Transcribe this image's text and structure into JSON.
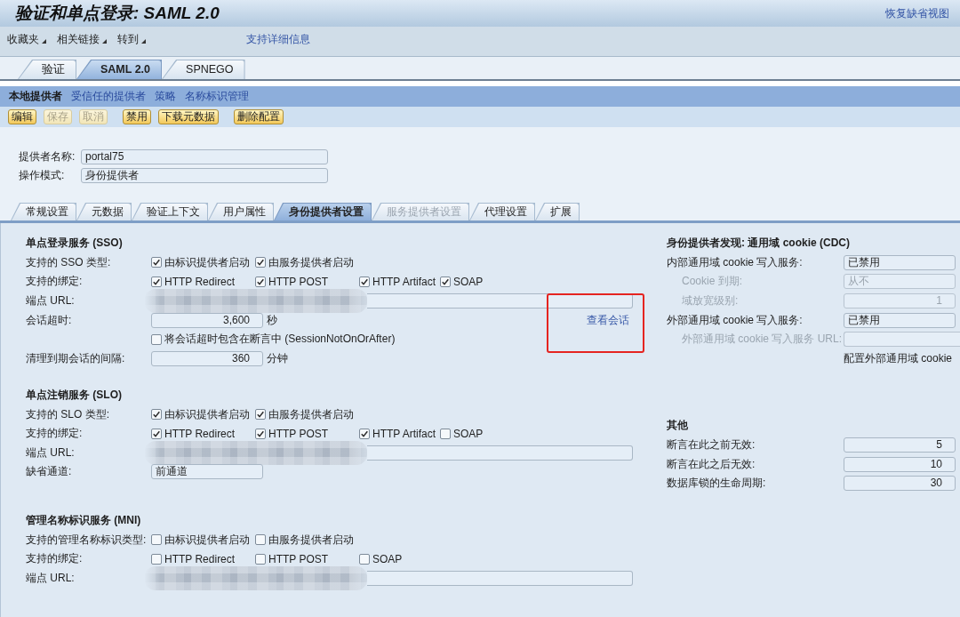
{
  "header": {
    "title": "验证和单点登录: SAML 2.0",
    "restore_link": "恢复缺省视图"
  },
  "menu": {
    "items": [
      "收藏夹",
      "相关链接",
      "转到"
    ],
    "support_link": "支持详细信息"
  },
  "top_tabs": [
    {
      "label": "验证",
      "selected": false
    },
    {
      "label": "SAML 2.0",
      "selected": true
    },
    {
      "label": "SPNEGO",
      "selected": false
    }
  ],
  "subnav": [
    {
      "label": "本地提供者",
      "selected": true
    },
    {
      "label": "受信任的提供者",
      "selected": false
    },
    {
      "label": "策略",
      "selected": false
    },
    {
      "label": "名称标识管理",
      "selected": false
    }
  ],
  "toolbar": {
    "groups": [
      [
        {
          "label": "编辑",
          "disabled": false
        },
        {
          "label": "保存",
          "disabled": true
        },
        {
          "label": "取消",
          "disabled": true
        }
      ],
      [
        {
          "label": "禁用",
          "disabled": false
        },
        {
          "label": "下载元数据",
          "disabled": false
        }
      ],
      [
        {
          "label": "删除配置",
          "disabled": false
        }
      ]
    ]
  },
  "provider": [
    {
      "label": "提供者名称:",
      "value": "portal75"
    },
    {
      "label": "操作模式:",
      "value": "身份提供者"
    }
  ],
  "detail_tabs": [
    {
      "label": "常规设置",
      "selected": false,
      "disabled": false
    },
    {
      "label": "元数据",
      "selected": false,
      "disabled": false
    },
    {
      "label": "验证上下文",
      "selected": false,
      "disabled": false
    },
    {
      "label": "用户属性",
      "selected": false,
      "disabled": false
    },
    {
      "label": "身份提供者设置",
      "selected": true,
      "disabled": false
    },
    {
      "label": "服务提供者设置",
      "selected": false,
      "disabled": true
    },
    {
      "label": "代理设置",
      "selected": false,
      "disabled": false
    },
    {
      "label": "扩展",
      "selected": false,
      "disabled": false
    }
  ],
  "left_sections": [
    {
      "title": "单点登录服务 (SSO)",
      "rows": [
        {
          "kind": "checks",
          "label": "支持的 SSO 类型:",
          "options": [
            {
              "label": "由标识提供者启动",
              "checked": true
            },
            {
              "label": "由服务提供者启动",
              "checked": true
            }
          ]
        },
        {
          "kind": "checks",
          "label": "支持的绑定:",
          "options": [
            {
              "label": "HTTP Redirect",
              "checked": true
            },
            {
              "label": "HTTP POST",
              "checked": true
            },
            {
              "label": "HTTP Artifact",
              "checked": true
            },
            {
              "label": "SOAP",
              "checked": true
            }
          ]
        },
        {
          "kind": "url",
          "label": "端点 URL:",
          "redacted": true
        },
        {
          "kind": "number",
          "label": "会话超时:",
          "value": "3,600",
          "unit": "秒",
          "link": {
            "label": "查看会话",
            "highlighted": true
          }
        },
        {
          "kind": "checks",
          "options": [
            {
              "label": "将会话超时包含在断言中 (SessionNotOnOrAfter)",
              "checked": false
            }
          ]
        },
        {
          "kind": "number",
          "label": "清理到期会话的间隔:",
          "value": "360",
          "unit": "分钟"
        }
      ]
    },
    {
      "title": "单点注销服务 (SLO)",
      "rows": [
        {
          "kind": "checks",
          "label": "支持的 SLO 类型:",
          "options": [
            {
              "label": "由标识提供者启动",
              "checked": true
            },
            {
              "label": "由服务提供者启动",
              "checked": true
            }
          ]
        },
        {
          "kind": "checks",
          "label": "支持的绑定:",
          "options": [
            {
              "label": "HTTP Redirect",
              "checked": true
            },
            {
              "label": "HTTP POST",
              "checked": true
            },
            {
              "label": "HTTP Artifact",
              "checked": true
            },
            {
              "label": "SOAP",
              "checked": false
            }
          ]
        },
        {
          "kind": "url",
          "label": "端点 URL:",
          "redacted": true
        },
        {
          "kind": "text",
          "label": "缺省通道:",
          "value": "前通道"
        }
      ]
    },
    {
      "title": "管理名称标识服务 (MNI)",
      "rows": [
        {
          "kind": "checks",
          "label": "支持的管理名称标识类型:",
          "options": [
            {
              "label": "由标识提供者启动",
              "checked": false
            },
            {
              "label": "由服务提供者启动",
              "checked": false
            }
          ]
        },
        {
          "kind": "checks",
          "label": "支持的绑定:",
          "options": [
            {
              "label": "HTTP Redirect",
              "checked": false
            },
            {
              "label": "HTTP POST",
              "checked": false
            },
            {
              "label": "SOAP",
              "checked": false
            }
          ]
        },
        {
          "kind": "url",
          "label": "端点 URL:",
          "redacted": true
        }
      ]
    }
  ],
  "right_sections": [
    {
      "title": "身份提供者发现: 通用域 cookie (CDC)",
      "rows": [
        {
          "kind": "text",
          "label": "内部通用域 cookie 写入服务:",
          "value": "已禁用",
          "disabled": false,
          "children": [
            {
              "kind": "text",
              "label": "Cookie 到期:",
              "value": "从不",
              "disabled": true
            },
            {
              "kind": "number",
              "label": "域放宽级别:",
              "value": "1",
              "disabled": true
            }
          ]
        },
        {
          "kind": "text",
          "label": "外部通用域 cookie 写入服务:",
          "value": "已禁用",
          "disabled": false,
          "children": [
            {
              "kind": "url",
              "label": "外部通用域 cookie 写入服务 URL:",
              "disabled": true
            }
          ]
        },
        {
          "kind": "note",
          "value": "配置外部通用域 cookie"
        }
      ]
    },
    {
      "title": "其他",
      "rows": [
        {
          "kind": "number",
          "label": "断言在此之前无效:",
          "value": "5",
          "disabled": false
        },
        {
          "kind": "number",
          "label": "断言在此之后无效:",
          "value": "10",
          "disabled": false
        },
        {
          "kind": "number",
          "label": "数据库锁的生命周期:",
          "value": "30",
          "disabled": false
        }
      ]
    }
  ]
}
